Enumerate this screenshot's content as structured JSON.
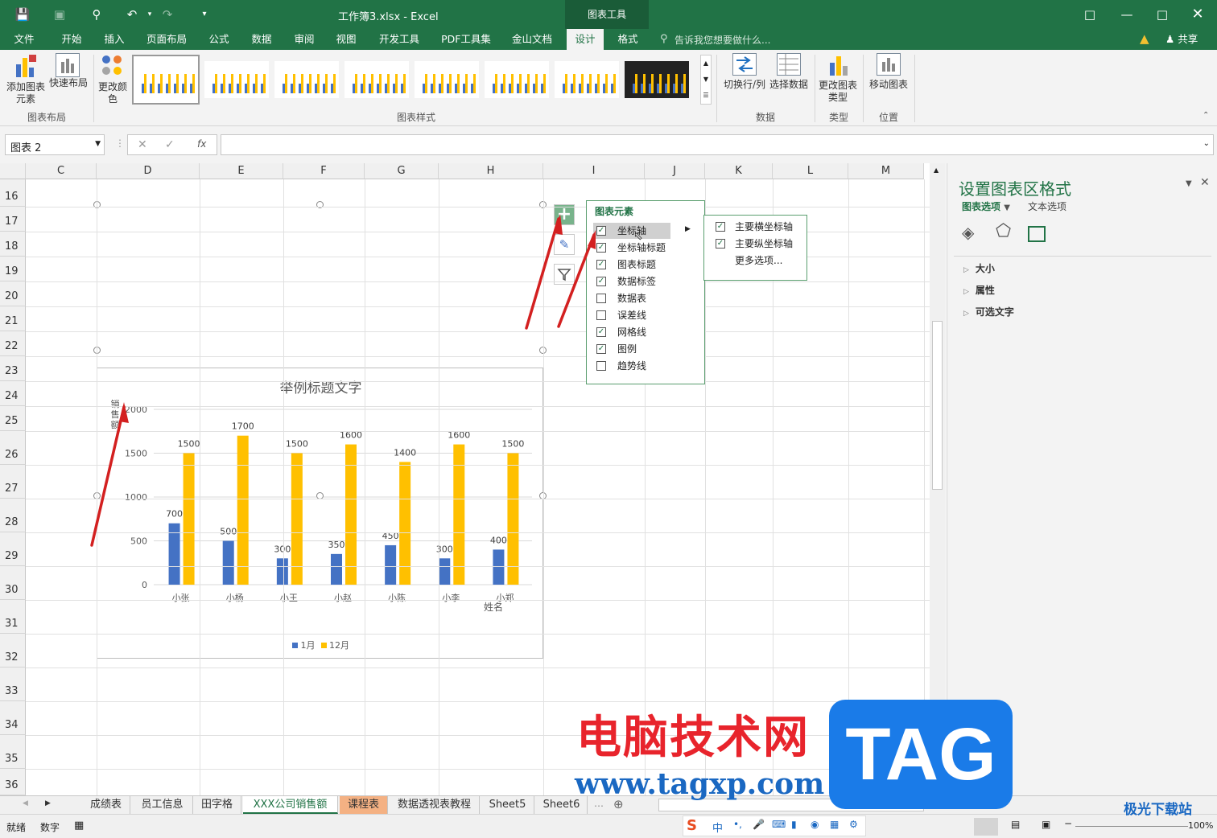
{
  "window": {
    "title": "工作簿3.xlsx - Excel",
    "context_tab": "图表工具"
  },
  "tabs": [
    "文件",
    "开始",
    "插入",
    "页面布局",
    "公式",
    "数据",
    "审阅",
    "视图",
    "开发工具",
    "PDF工具集",
    "金山文档",
    "设计",
    "格式"
  ],
  "tellme": "告诉我您想要做什么...",
  "share": "共享",
  "ribbon": {
    "add_element": "添加图表元素",
    "quick_layout": "快速布局",
    "change_color": "更改颜色",
    "switch_rowcol": "切换行/列",
    "select_data": "选择数据",
    "change_type": "更改图表类型",
    "move_chart": "移动图表",
    "groups": {
      "layout": "图表布局",
      "styles": "图表样式",
      "data": "数据",
      "type": "类型",
      "location": "位置"
    }
  },
  "formula_bar": {
    "name_box": "图表 2",
    "fx": "fx",
    "value": ""
  },
  "columns": [
    "C",
    "D",
    "E",
    "F",
    "G",
    "H",
    "I",
    "J",
    "K",
    "L",
    "M"
  ],
  "rows": [
    "16",
    "17",
    "18",
    "19",
    "20",
    "21",
    "22",
    "23",
    "24",
    "25",
    "26",
    "27",
    "28",
    "29",
    "30",
    "31",
    "32",
    "33",
    "34",
    "35",
    "36"
  ],
  "chart_data": {
    "type": "bar",
    "title": "举例标题文字",
    "ylabel": "销售额",
    "xlabel": "姓名",
    "categories": [
      "小张",
      "小杨",
      "小王",
      "小赵",
      "小陈",
      "小李",
      "小郑"
    ],
    "ylim": [
      0,
      2000
    ],
    "yticks": [
      "0",
      "500",
      "1000",
      "1500",
      "2000"
    ],
    "series": [
      {
        "name": "1月",
        "values": [
          700,
          500,
          300,
          350,
          450,
          300,
          400
        ],
        "color": "#4472c4"
      },
      {
        "name": "12月",
        "values": [
          1500,
          1700,
          1500,
          1600,
          1400,
          1600,
          1500
        ],
        "color": "#ffc000"
      }
    ],
    "grid": true,
    "legend": "bottom"
  },
  "chart_elements": {
    "title": "图表元素",
    "items": [
      {
        "label": "坐标轴",
        "checked": true
      },
      {
        "label": "坐标轴标题",
        "checked": true
      },
      {
        "label": "图表标题",
        "checked": true
      },
      {
        "label": "数据标签",
        "checked": true
      },
      {
        "label": "数据表",
        "checked": false
      },
      {
        "label": "误差线",
        "checked": false
      },
      {
        "label": "网格线",
        "checked": true
      },
      {
        "label": "图例",
        "checked": true
      },
      {
        "label": "趋势线",
        "checked": false
      }
    ],
    "sub": [
      {
        "label": "主要横坐标轴",
        "checked": true
      },
      {
        "label": "主要纵坐标轴",
        "checked": true
      },
      {
        "label": "更多选项...",
        "checked": null
      }
    ]
  },
  "pane": {
    "title": "设置图表区格式",
    "tab_chart": "图表选项",
    "tab_text": "文本选项",
    "sections": [
      "大小",
      "属性",
      "可选文字"
    ]
  },
  "sheets": [
    "成绩表",
    "员工信息",
    "田字格",
    "XXX公司销售额",
    "课程表",
    "数据透视表教程",
    "Sheet5",
    "Sheet6"
  ],
  "status": {
    "ready": "就绪",
    "mode": "数字",
    "zoom": "100%"
  },
  "watermark": {
    "cn": "电脑技术网",
    "url": "www.tagxp.com",
    "tag": "TAG",
    "brand": "极光下载站"
  }
}
